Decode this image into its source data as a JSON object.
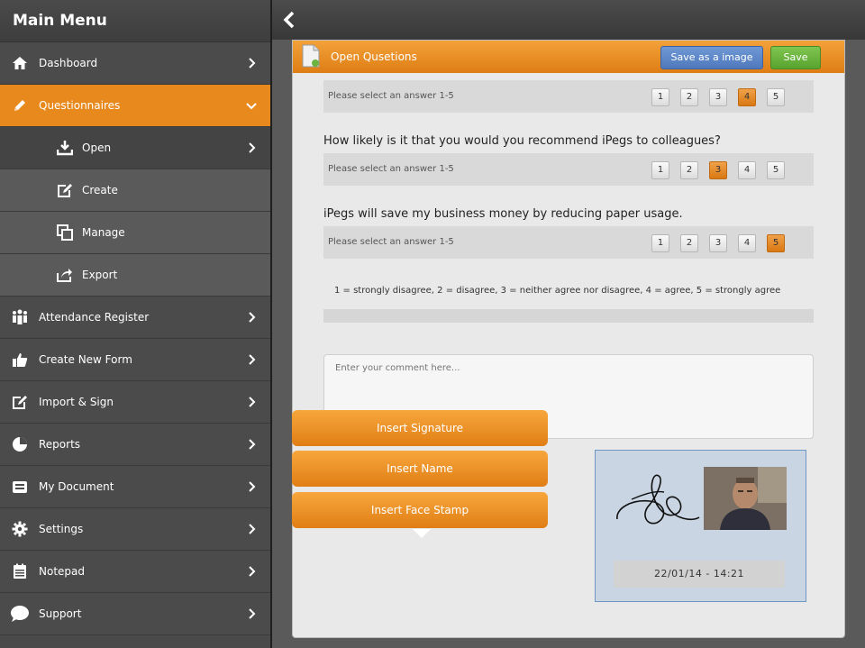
{
  "sidebar": {
    "title": "Main Menu",
    "items": [
      {
        "label": "Dashboard",
        "icon": "home-icon"
      },
      {
        "label": "Questionnaires",
        "icon": "pencil-icon"
      },
      {
        "label": "Open",
        "icon": "download-icon"
      },
      {
        "label": "Create",
        "icon": "edit-icon"
      },
      {
        "label": "Manage",
        "icon": "copy-icon"
      },
      {
        "label": "Export",
        "icon": "share-icon"
      },
      {
        "label": "Attendance Register",
        "icon": "people-icon"
      },
      {
        "label": "Create New Form",
        "icon": "thumbs-up-icon"
      },
      {
        "label": "Import & Sign",
        "icon": "edit-icon"
      },
      {
        "label": "Reports",
        "icon": "pie-chart-icon"
      },
      {
        "label": "My Document",
        "icon": "inbox-icon"
      },
      {
        "label": "Settings",
        "icon": "gear-icon"
      },
      {
        "label": "Notepad",
        "icon": "notepad-icon"
      },
      {
        "label": "Support",
        "icon": "chat-bubble-icon"
      }
    ]
  },
  "panel": {
    "title": "Open Qusetions",
    "save_image_label": "Save as a image",
    "save_label": "Save"
  },
  "questions": [
    {
      "text": "",
      "placeholder": "Please select an answer 1-5",
      "selected": 4
    },
    {
      "text": "How likely is it that you would you recommend iPegs to colleagues?",
      "placeholder": "Please select an answer 1-5",
      "selected": 3
    },
    {
      "text": "iPegs will save my business money by reducing paper usage.",
      "placeholder": "Please select an answer 1-5",
      "selected": 5
    }
  ],
  "options": [
    "1",
    "2",
    "3",
    "4",
    "5"
  ],
  "legend": "1 = strongly disagree,  2 = disagree,  3 = neither agree nor disagree, 4 = agree, 5 = strongly agree",
  "comment": {
    "placeholder": "Enter your comment here..."
  },
  "popup": {
    "insert_signature": "Insert Signature",
    "insert_name": "Insert Name",
    "insert_face_stamp": "Insert Face Stamp"
  },
  "signature": {
    "timestamp": "22/01/14 - 14:21"
  },
  "colors": {
    "accent": "#e8891d",
    "save_image": "#5a84c8",
    "save": "#6bb43f"
  }
}
